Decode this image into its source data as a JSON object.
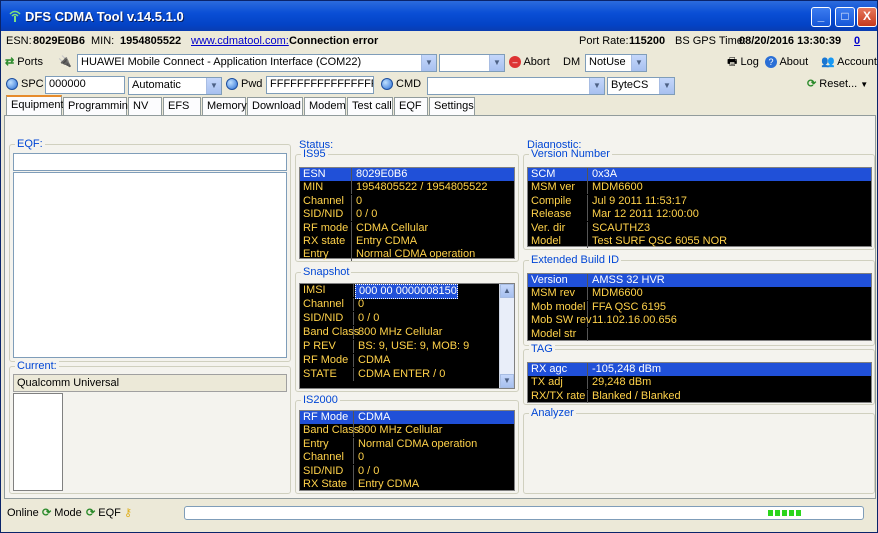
{
  "window": {
    "title": "DFS CDMA Tool v.14.5.1.0",
    "buttons": {
      "min": "_",
      "max": "□",
      "close": "X"
    }
  },
  "infobar": {
    "esn_label": "ESN:",
    "esn": "8029E0B6",
    "min_label": "MIN:",
    "min": "1954805522",
    "link": "www.cdmatool.com:",
    "conn": "Connection error",
    "rate_label": "Port Rate:",
    "rate": "115200",
    "gps_label": "BS GPS Time:",
    "gps": "08/20/2016 13:30:39",
    "zero": "0"
  },
  "toolbar1": {
    "ports": "Ports",
    "port_value": "HUAWEI Mobile Connect - Application Interface (COM22)",
    "abort": "Abort",
    "dm_label": "DM",
    "dm_value": "NotUse",
    "log": "Log",
    "about": "About",
    "account": "Account"
  },
  "toolbar2": {
    "spc_label": "SPC",
    "spc_value": "000000",
    "mode_value": "Automatic",
    "pwd_label": "Pwd",
    "pwd_value": "FFFFFFFFFFFFFFFF",
    "cmd_label": "CMD",
    "cmd_value": "",
    "enc_value": "ByteCS",
    "reset": "Reset..."
  },
  "tabs": [
    "Equipment",
    "Programming",
    "NV",
    "EFS",
    "Memory",
    "Download",
    "Modem",
    "Test call",
    "EQF",
    "Settings"
  ],
  "eqf": {
    "title": "EQF:",
    "current_title": "Current:",
    "current_value": "Qualcomm Universal"
  },
  "status_panel": {
    "title": "Status:",
    "is95": {
      "title": "IS95",
      "rows": [
        [
          "ESN",
          "8029E0B6"
        ],
        [
          "MIN",
          "1954805522 / 1954805522"
        ],
        [
          "Channel",
          "0"
        ],
        [
          "SID/NID",
          "0 / 0"
        ],
        [
          "RF mode",
          "CDMA  Cellular"
        ],
        [
          "RX state",
          "Entry  CDMA"
        ],
        [
          "Entry",
          "Normal  CDMA  operation"
        ]
      ]
    },
    "snapshot": {
      "title": "Snapshot",
      "rows": [
        [
          "IMSI",
          "000 00 0000008150"
        ],
        [
          "Channel",
          "0"
        ],
        [
          "SID/NID",
          "0 / 0"
        ],
        [
          "Band Class",
          "800 MHz Cellular"
        ],
        [
          "P REV",
          "BS: 9, USE: 9, MOB: 9"
        ],
        [
          "RF Mode",
          "CDMA"
        ],
        [
          "STATE",
          "CDMA  ENTER / 0"
        ]
      ]
    },
    "is2000": {
      "title": "IS2000",
      "rows": [
        [
          "RF Mode",
          "CDMA"
        ],
        [
          "Band Class",
          "800 MHz Cellular"
        ],
        [
          "Entry",
          "Normal  CDMA  operation"
        ],
        [
          "Channel",
          "0"
        ],
        [
          "SID/NID",
          "0 / 0"
        ],
        [
          "RX State",
          "Entry  CDMA"
        ]
      ]
    }
  },
  "diag": {
    "title": "Diagnostic:",
    "version": {
      "title": "Version Number",
      "rows": [
        [
          "SCM",
          "0x3A"
        ],
        [
          "MSM ver",
          "MDM6600"
        ],
        [
          "Compile",
          "Jul  9 2011 11:53:17"
        ],
        [
          "Release",
          "Mar 12 2011 12:00:00"
        ],
        [
          "Ver. dir",
          "SCAUTHZ3"
        ],
        [
          "Model",
          "Test  SURF  QSC  6055  NOR"
        ]
      ]
    },
    "ext": {
      "title": "Extended Build ID",
      "rows": [
        [
          "Version",
          "AMSS  32  HVR"
        ],
        [
          "MSM rev",
          "MDM6600"
        ],
        [
          "Mob model",
          "FFA  QSC  6195"
        ],
        [
          "Mob SW rev",
          "11.102.16.00.656"
        ],
        [
          "Model str",
          ""
        ]
      ]
    },
    "tag": {
      "title": "TAG",
      "rows": [
        [
          "RX agc",
          "-105,248 dBm"
        ],
        [
          "TX adj",
          "29,248 dBm"
        ],
        [
          "RX/TX rate",
          "Blanked / Blanked"
        ]
      ]
    },
    "analyzer": {
      "title": "Analyzer"
    }
  },
  "statusbar": {
    "online": "Online",
    "mode": "Mode",
    "eqf": "EQF",
    "progress_fraction": 1.0
  },
  "colors": {
    "table_bg": "#000000",
    "table_text": "#ffd24a",
    "highlight": "#2050d8",
    "title_blue": "#0a4fd6"
  }
}
